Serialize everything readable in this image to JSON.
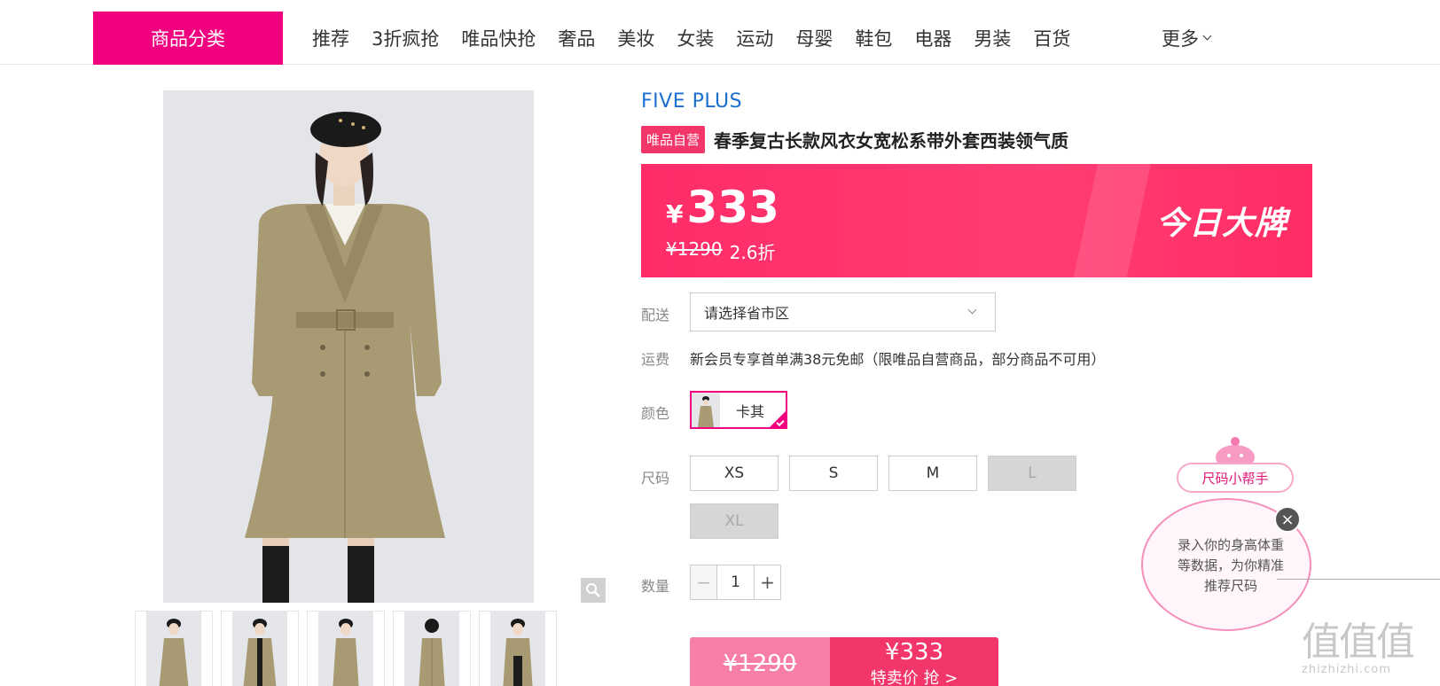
{
  "nav": {
    "category_button": "商品分类",
    "items": [
      "推荐",
      "3折疯抢",
      "唯品快抢",
      "奢品",
      "美妆",
      "女装",
      "运动",
      "母婴",
      "鞋包",
      "电器",
      "男装",
      "百货"
    ],
    "more": "更多"
  },
  "product": {
    "brand": "FIVE PLUS",
    "self_tag": "唯品自营",
    "title": "春季复古长款风衣女宽松系带外套西装领气质"
  },
  "price": {
    "currency": "¥",
    "now": "333",
    "original": "¥1290",
    "discount": "2.6折",
    "badge": "今日大牌"
  },
  "shipping": {
    "label": "配送",
    "select_value": "请选择省市区"
  },
  "freight": {
    "label": "运费",
    "text": "新会员专享首单满38元免邮（限唯品自营商品，部分商品不可用）"
  },
  "color": {
    "label": "颜色",
    "selected": "卡其"
  },
  "size": {
    "label": "尺码",
    "options": [
      {
        "name": "XS",
        "available": true
      },
      {
        "name": "S",
        "available": true
      },
      {
        "name": "M",
        "available": true
      },
      {
        "name": "L",
        "available": false
      },
      {
        "name": "XL",
        "available": false
      }
    ]
  },
  "quantity": {
    "label": "数量",
    "value": "1",
    "minus": "−",
    "plus": "+"
  },
  "buy": {
    "original": "¥1290",
    "price": "¥333",
    "action": "特卖价 抢 >"
  },
  "helper": {
    "title": "尺码小帮手",
    "text": "录入你的身高体重等数据，为你精准推荐尺码",
    "close": "×"
  },
  "watermark": {
    "logo": "值值值",
    "url": "zhizhizhi.com"
  },
  "colors": {
    "accent": "#f10180",
    "price_banner": "#ff2c68",
    "brand_blue": "#1a6fd1"
  }
}
